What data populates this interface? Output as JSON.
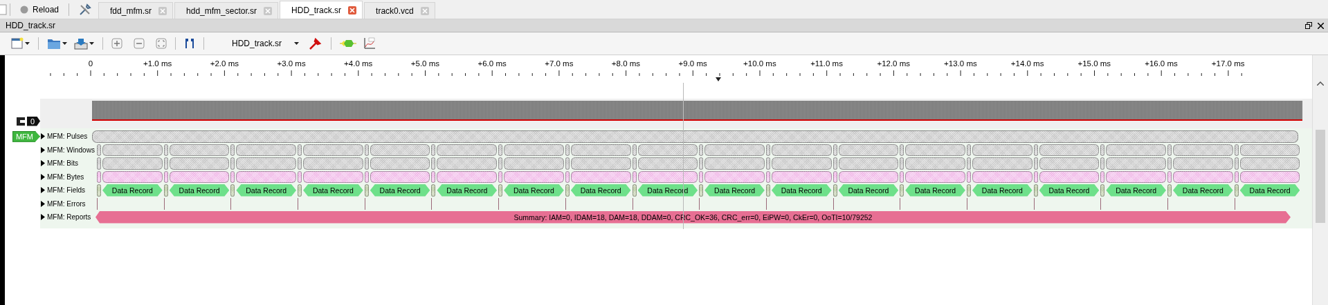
{
  "tab_bar": {
    "reload": "Reload",
    "tabs": [
      {
        "label": "fdd_mfm.sr",
        "selected": false
      },
      {
        "label": "hdd_mfm_sector.sr",
        "selected": false
      },
      {
        "label": "HDD_track.sr",
        "selected": true
      },
      {
        "label": "track0.vcd",
        "selected": false
      }
    ]
  },
  "session": {
    "title": "HDD_track.sr"
  },
  "toolbar": {
    "device": "HDD_track.sr"
  },
  "ruler": {
    "labels": [
      "0",
      "+1.0 ms",
      "+2.0 ms",
      "+3.0 ms",
      "+4.0 ms",
      "+5.0 ms",
      "+6.0 ms",
      "+7.0 ms",
      "+8.0 ms",
      "+9.0 ms",
      "+10.0 ms",
      "+11.0 ms",
      "+12.0 ms",
      "+13.0 ms",
      "+14.0 ms",
      "+15.0 ms",
      "+16.0 ms",
      "+17.0 ms"
    ]
  },
  "channels": [
    {
      "label": "0",
      "kind": "logic"
    }
  ],
  "decoder": {
    "badge": "MFM",
    "rows": [
      {
        "label": "MFM: Pulses",
        "kind": "continuous",
        "color": "#c4c4c4"
      },
      {
        "label": "MFM: Windows",
        "kind": "segmented",
        "color": "#c4c4c4"
      },
      {
        "label": "MFM: Bits",
        "kind": "segmented",
        "color": "#c4c4c4"
      },
      {
        "label": "MFM: Bytes",
        "kind": "segmented",
        "color": "#f0b4e6"
      },
      {
        "label": "MFM: Fields",
        "kind": "labeled",
        "color": "#6ee08a",
        "annotations": [
          "Data Record",
          "Data Record",
          "Data Record",
          "Data Record",
          "Data Record",
          "Data Record",
          "Data Record",
          "Data Record",
          "Data Record",
          "Data Record",
          "Data Record",
          "Data Record",
          "Data Record",
          "Data Record",
          "Data Record",
          "Data Record",
          "Data Record",
          "Data Record"
        ]
      },
      {
        "label": "MFM: Errors",
        "kind": "marks",
        "color": "#9a6878"
      },
      {
        "label": "MFM: Reports",
        "kind": "summary",
        "color": "#e76f93",
        "text": "Summary: IAM=0, IDAM=18, DAM=18, DDAM=0, CRC_OK=36, CRC_err=0, EiPW=0, CkEr=0, OoTI=10/79252"
      }
    ]
  }
}
